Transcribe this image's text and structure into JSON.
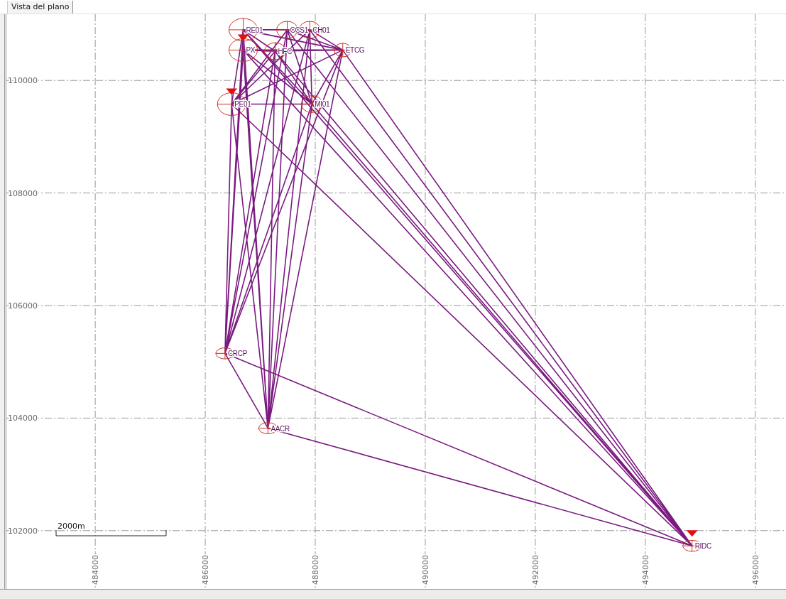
{
  "tabs": [
    {
      "label": "Vista del plano",
      "selected": true
    }
  ],
  "plan_view": {
    "stations": [
      {
        "name": "RE01",
        "kind": "round",
        "fixed": false
      },
      {
        "name": "CCS1",
        "kind": "round",
        "fixed": false
      },
      {
        "name": "CH01",
        "kind": "round",
        "fixed": false
      },
      {
        "name": "PX",
        "kind": "round",
        "fixed": true
      },
      {
        "name": "HFC",
        "kind": "round",
        "fixed": false
      },
      {
        "name": "ETCG",
        "kind": "round",
        "fixed": false
      },
      {
        "name": "PE01",
        "kind": "round",
        "fixed": true
      },
      {
        "name": "MI01",
        "kind": "round",
        "fixed": false
      },
      {
        "name": "CRCP",
        "kind": "flat",
        "fixed": false
      },
      {
        "name": "AACR",
        "kind": "flat",
        "fixed": false
      },
      {
        "name": "RIDC",
        "kind": "flat",
        "fixed": true
      }
    ],
    "scale_bar": "2000m",
    "chart_data": {
      "type": "scatter",
      "grid": true,
      "xlim": [
        482385,
        496558
      ],
      "ylim": [
        100962,
        111177
      ],
      "xticks": [
        484000,
        486000,
        488000,
        490000,
        492000,
        494000,
        496000
      ],
      "yticks": [
        102000,
        104000,
        106000,
        108000,
        110000
      ],
      "series": [
        {
          "color": "#cc3322",
          "sizes": [
            1,
            0.56,
            0.56,
            1,
            0.56,
            0.36,
            1,
            0.56,
            0.32,
            0.32,
            0.32
          ],
          "x": [
            486690,
            487490,
            487900,
            486690,
            487270,
            488500,
            486480,
            487940,
            486360,
            487140,
            494850
          ],
          "values": [
            110900,
            110900,
            110900,
            110540,
            110520,
            110540,
            109580,
            109580,
            105150,
            103820,
            101730
          ]
        }
      ]
    }
  }
}
